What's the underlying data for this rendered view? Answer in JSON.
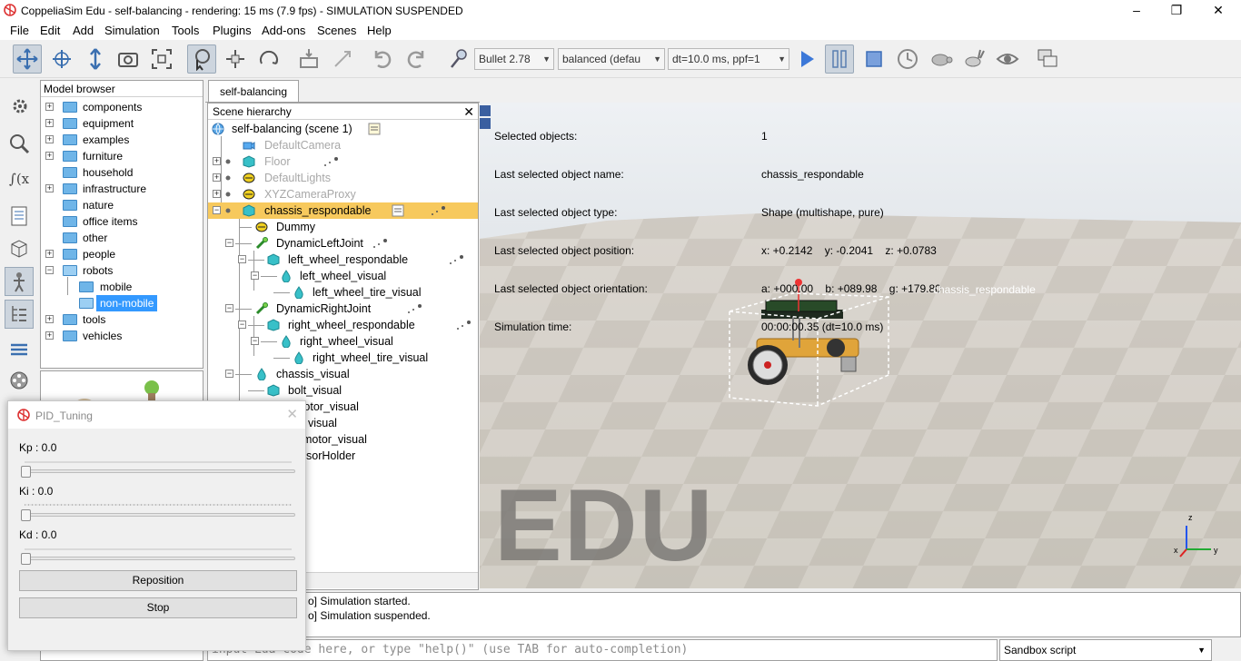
{
  "window": {
    "title": "CoppeliaSim Edu - self-balancing - rendering: 15 ms (7.9 fps) - SIMULATION SUSPENDED",
    "minimize": "–",
    "maximize": "❐",
    "close": "✕"
  },
  "menu": [
    "File",
    "Edit",
    "Add",
    "Simulation",
    "Tools",
    "Plugins",
    "Add-ons",
    "Scenes",
    "Help"
  ],
  "toolbar": {
    "engine": "Bullet 2.78",
    "mode": "balanced (defau",
    "dt": "dt=10.0 ms, ppf=1"
  },
  "model_browser": {
    "title": "Model browser",
    "items": [
      {
        "label": "components"
      },
      {
        "label": "equipment"
      },
      {
        "label": "examples"
      },
      {
        "label": "furniture"
      },
      {
        "label": "household"
      },
      {
        "label": "infrastructure"
      },
      {
        "label": "nature"
      },
      {
        "label": "office items"
      },
      {
        "label": "other"
      },
      {
        "label": "people"
      },
      {
        "label": "robots"
      },
      {
        "label": "mobile"
      },
      {
        "label": "non-mobile"
      },
      {
        "label": "tools"
      },
      {
        "label": "vehicles"
      }
    ]
  },
  "scene_tab": "self-balancing",
  "hierarchy": {
    "title": "Scene hierarchy",
    "close": "✕",
    "rows": [
      {
        "label": "self-balancing (scene 1)"
      },
      {
        "label": "DefaultCamera"
      },
      {
        "label": "Floor"
      },
      {
        "label": "DefaultLights"
      },
      {
        "label": "XYZCameraProxy"
      },
      {
        "label": "chassis_respondable"
      },
      {
        "label": "Dummy"
      },
      {
        "label": "DynamicLeftJoint"
      },
      {
        "label": "left_wheel_respondable"
      },
      {
        "label": "left_wheel_visual"
      },
      {
        "label": "left_wheel_tire_visual"
      },
      {
        "label": "DynamicRightJoint"
      },
      {
        "label": "right_wheel_respondable"
      },
      {
        "label": "right_wheel_visual"
      },
      {
        "label": "right_wheel_tire_visual"
      },
      {
        "label": "chassis_visual"
      },
      {
        "label": "bolt_visual"
      },
      {
        "label": "motor_visual"
      },
      {
        "label": "visual"
      },
      {
        "label": "motor_visual"
      },
      {
        "label": "sorHolder"
      }
    ]
  },
  "info": {
    "labels": [
      "Selected objects:",
      "Last selected object name:",
      "Last selected object type:",
      "Last selected object position:",
      "Last selected object orientation:",
      "Simulation time:"
    ],
    "values": [
      "1",
      "chassis_respondable",
      "Shape (multishape, pure)",
      "x: +0.2142    y: -0.2041    z: +0.0783",
      "a: +000.00    b: +089.98    g: +179.80",
      "00:00:00.35 (dt=10.0 ms)"
    ]
  },
  "viewport": {
    "object_label": "chassis_respondable",
    "watermark": "EDU",
    "axis_z": "z",
    "axis_x": "x",
    "axis_y": "y"
  },
  "console": {
    "line1": "o] Simulation started.",
    "line2": "o] Simulation suspended."
  },
  "command": {
    "placeholder": "input Lua code here, or type \"help()\" (use TAB for auto-completion)",
    "script_selector": "Sandbox script"
  },
  "pid_dialog": {
    "title": "PID_Tuning",
    "close": "✕",
    "kp_label": "Kp :  0.0",
    "ki_label": "Ki :  0.0",
    "kd_label": "Kd :  0.0",
    "kp_value": 0.0,
    "ki_value": 0.0,
    "kd_value": 0.0,
    "reposition": "Reposition",
    "stop": "Stop"
  },
  "colors": {
    "selection_blue": "#3399ff",
    "hierarchy_selected": "#f7c95d",
    "floor_light": "#d9d4cc",
    "floor_dark": "#bdb7ad"
  }
}
